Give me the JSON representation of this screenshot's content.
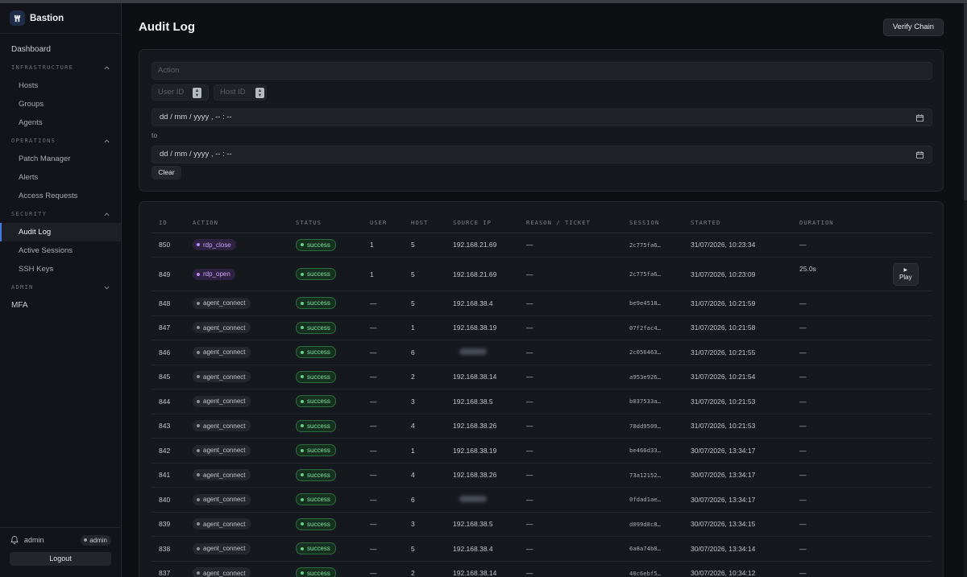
{
  "brand": {
    "name": "Bastion",
    "logo_icon": "bastion-logo"
  },
  "sidebar": {
    "dashboard": "Dashboard",
    "sections": [
      {
        "label": "INFRASTRUCTURE",
        "items": [
          "Hosts",
          "Groups",
          "Agents"
        ]
      },
      {
        "label": "OPERATIONS",
        "items": [
          "Patch Manager",
          "Alerts",
          "Access Requests"
        ]
      },
      {
        "label": "SECURITY",
        "items": [
          "Audit Log",
          "Active Sessions",
          "SSH Keys"
        ]
      },
      {
        "label": "ADMIN",
        "items": []
      }
    ],
    "mfa": "MFA",
    "active_item": "Audit Log",
    "footer": {
      "user": "admin",
      "role": "admin",
      "logout": "Logout"
    }
  },
  "header": {
    "title": "Audit Log",
    "verify_button": "Verify Chain"
  },
  "filters": {
    "action_placeholder": "Action",
    "user_id_placeholder": "User ID",
    "host_id_placeholder": "Host ID",
    "date_from": "dd / mm / yyyy ,  -- : --",
    "to_label": "to",
    "date_to": "dd / mm / yyyy ,  -- : --",
    "clear_button": "Clear"
  },
  "table": {
    "columns": [
      "ID",
      "ACTION",
      "STATUS",
      "USER",
      "HOST",
      "SOURCE IP",
      "REASON / TICKET",
      "SESSION",
      "STARTED",
      "DURATION"
    ],
    "play_label": "Play",
    "rows": [
      {
        "id": "850",
        "action": "rdp_close",
        "status": "success",
        "user": "1",
        "host": "5",
        "ip": "192.168.21.69",
        "reason": "—",
        "session": "2c775fa6…",
        "started": "31/07/2026, 10:23:34",
        "duration": "—"
      },
      {
        "id": "849",
        "action": "rdp_open",
        "status": "success",
        "user": "1",
        "host": "5",
        "ip": "192.168.21.69",
        "reason": "—",
        "session": "2c775fa6…",
        "started": "31/07/2026, 10:23:09",
        "duration": "25.0s",
        "play": true
      },
      {
        "id": "848",
        "action": "agent_connect",
        "status": "success",
        "user": "—",
        "host": "5",
        "ip": "192.168.38.4",
        "reason": "—",
        "session": "be9e4518…",
        "started": "31/07/2026, 10:21:59",
        "duration": "—"
      },
      {
        "id": "847",
        "action": "agent_connect",
        "status": "success",
        "user": "—",
        "host": "1",
        "ip": "192.168.38.19",
        "reason": "—",
        "session": "07f2fac4…",
        "started": "31/07/2026, 10:21:58",
        "duration": "—"
      },
      {
        "id": "846",
        "action": "agent_connect",
        "status": "success",
        "user": "—",
        "host": "6",
        "ip": "",
        "reason": "—",
        "session": "2c056463…",
        "started": "31/07/2026, 10:21:55",
        "duration": "—"
      },
      {
        "id": "845",
        "action": "agent_connect",
        "status": "success",
        "user": "—",
        "host": "2",
        "ip": "192.168.38.14",
        "reason": "—",
        "session": "a953e926…",
        "started": "31/07/2026, 10:21:54",
        "duration": "—"
      },
      {
        "id": "844",
        "action": "agent_connect",
        "status": "success",
        "user": "—",
        "host": "3",
        "ip": "192.168.38.5",
        "reason": "—",
        "session": "b037533a…",
        "started": "31/07/2026, 10:21:53",
        "duration": "—"
      },
      {
        "id": "843",
        "action": "agent_connect",
        "status": "success",
        "user": "—",
        "host": "4",
        "ip": "192.168.38.26",
        "reason": "—",
        "session": "78dd9509…",
        "started": "31/07/2026, 10:21:53",
        "duration": "—"
      },
      {
        "id": "842",
        "action": "agent_connect",
        "status": "success",
        "user": "—",
        "host": "1",
        "ip": "192.168.38.19",
        "reason": "—",
        "session": "be466d33…",
        "started": "30/07/2026, 13:34:17",
        "duration": "—"
      },
      {
        "id": "841",
        "action": "agent_connect",
        "status": "success",
        "user": "—",
        "host": "4",
        "ip": "192.168.38.26",
        "reason": "—",
        "session": "73a12152…",
        "started": "30/07/2026, 13:34:17",
        "duration": "—"
      },
      {
        "id": "840",
        "action": "agent_connect",
        "status": "success",
        "user": "—",
        "host": "6",
        "ip": "",
        "reason": "—",
        "session": "0fdad1ae…",
        "started": "30/07/2026, 13:34:17",
        "duration": "—"
      },
      {
        "id": "839",
        "action": "agent_connect",
        "status": "success",
        "user": "—",
        "host": "3",
        "ip": "192.168.38.5",
        "reason": "—",
        "session": "d099d8c8…",
        "started": "30/07/2026, 13:34:15",
        "duration": "—"
      },
      {
        "id": "838",
        "action": "agent_connect",
        "status": "success",
        "user": "—",
        "host": "5",
        "ip": "192.168.38.4",
        "reason": "—",
        "session": "6a8a74b8…",
        "started": "30/07/2026, 13:34:14",
        "duration": "—"
      },
      {
        "id": "837",
        "action": "agent_connect",
        "status": "success",
        "user": "—",
        "host": "2",
        "ip": "192.168.38.14",
        "reason": "—",
        "session": "40c6ebf5…",
        "started": "30/07/2026, 10:34:12",
        "duration": "—"
      }
    ]
  },
  "colors": {
    "accent": "#3f7de0",
    "success": "#5fd18a",
    "rdp": "#b98af0"
  }
}
